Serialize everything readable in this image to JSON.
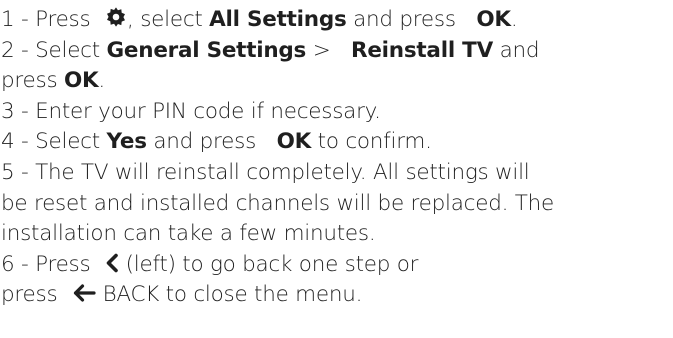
{
  "steps": [
    {
      "lines": [
        {
          "prefix": "1 - ",
          "t1": "Press ",
          "icon1": "gear-icon",
          "t2": ", select ",
          "b1": "All Settings",
          "t3": " and press ",
          "b2": "OK",
          "t4": "."
        }
      ]
    },
    {
      "lines": [
        {
          "prefix": "2 - ",
          "t1": "Select ",
          "b1": "General Settings",
          "t2": " > ",
          "b2": "Reinstall TV",
          "t3": " and"
        },
        {
          "t1": "press ",
          "b1": "OK",
          "t2": "."
        }
      ]
    },
    {
      "lines": [
        {
          "prefix": "3 - ",
          "t1": "Enter your PIN code if necessary."
        }
      ]
    },
    {
      "lines": [
        {
          "prefix": "4 - ",
          "t1": "Select ",
          "b1": "Yes",
          "t2": " and press ",
          "b2": "OK",
          "t3": " to confirm."
        }
      ]
    },
    {
      "lines": [
        {
          "prefix": "5 - ",
          "t1": "The TV will reinstall completely. All settings will"
        },
        {
          "t1": "be reset and installed channels will be replaced. The"
        },
        {
          "t1": "installation can take a few minutes."
        }
      ]
    },
    {
      "lines": [
        {
          "prefix": "6 - ",
          "t1": "Press ",
          "icon1": "chevron-left-icon",
          "t2": " (left) to go back one step or"
        },
        {
          "t1": "press ",
          "icon1": "arrow-left-icon",
          "t2": " BACK to close the menu."
        }
      ]
    }
  ]
}
